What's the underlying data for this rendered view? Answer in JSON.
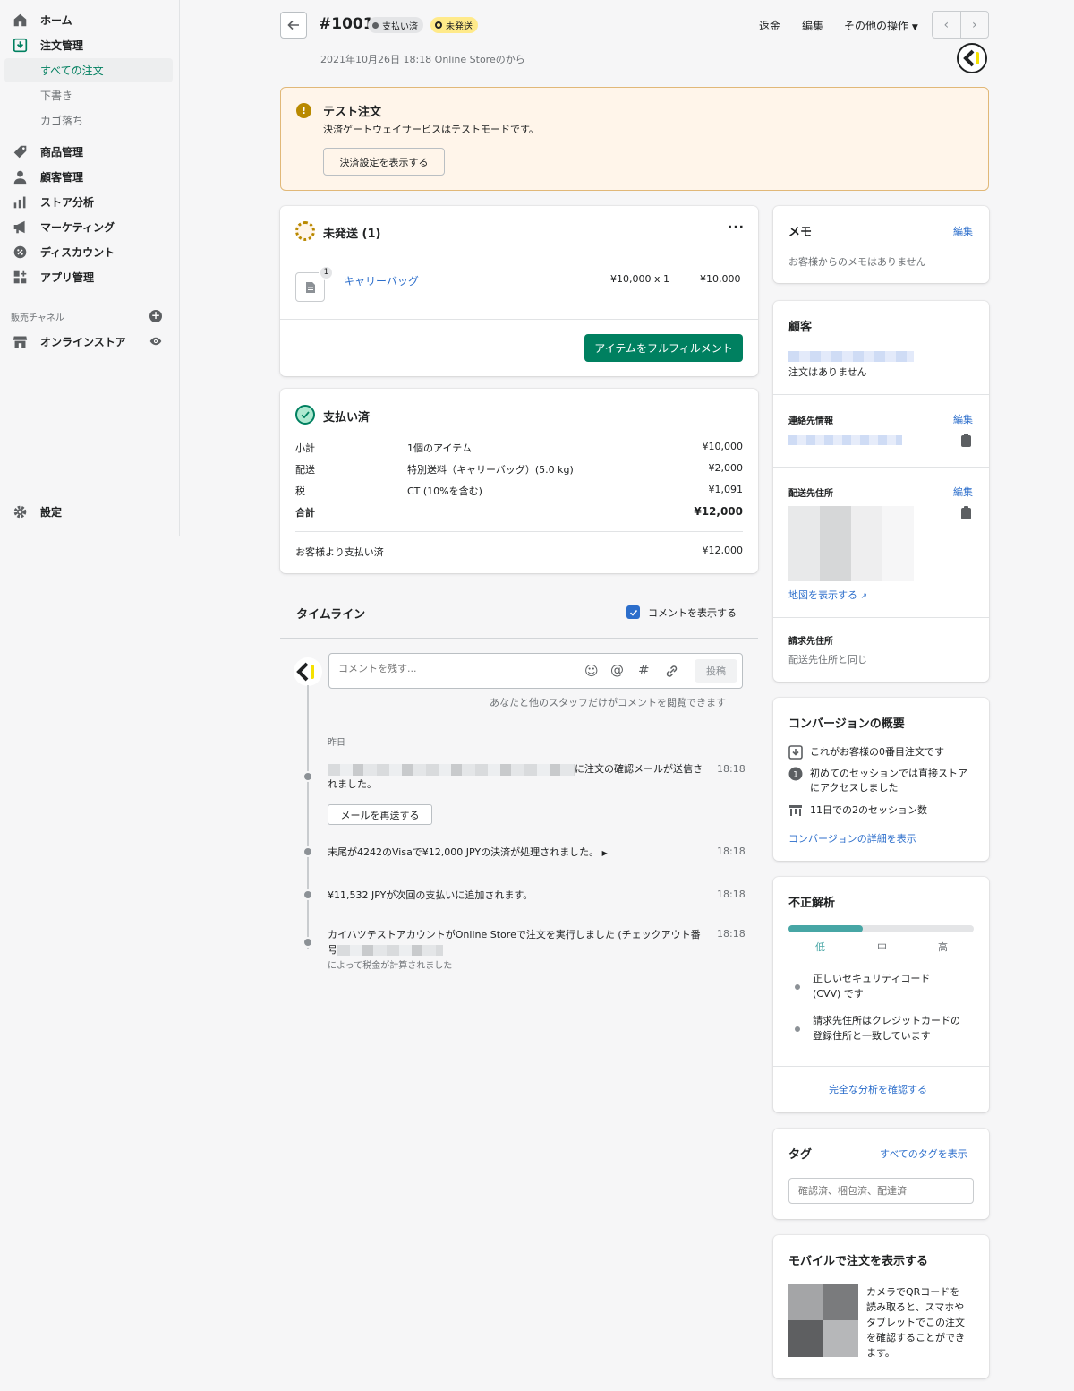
{
  "sidebar": {
    "items": [
      {
        "label": "ホーム",
        "icon": "home-icon"
      },
      {
        "label": "注文管理",
        "icon": "orders-icon"
      },
      {
        "label": "商品管理",
        "icon": "tag-icon"
      },
      {
        "label": "顧客管理",
        "icon": "person-icon"
      },
      {
        "label": "ストア分析",
        "icon": "analytics-icon"
      },
      {
        "label": "マーケティング",
        "icon": "megaphone-icon"
      },
      {
        "label": "ディスカウント",
        "icon": "discount-icon"
      },
      {
        "label": "アプリ管理",
        "icon": "apps-icon"
      }
    ],
    "orders_sub": [
      "すべての注文",
      "下書き",
      "カゴ落ち"
    ],
    "channels_label": "販売チャネル",
    "online_store": "オンラインストア",
    "settings": "設定"
  },
  "header": {
    "title": "#1001",
    "badge_paid": "支払い済",
    "badge_unfulfilled": "未発送",
    "subtitle": "2021年10月26日 18:18 Online Storeのから",
    "refund": "返金",
    "edit": "編集",
    "more_actions": "その他の操作"
  },
  "banner": {
    "title": "テスト注文",
    "text": "決済ゲートウェイサービスはテストモードです。",
    "button": "決済設定を表示する"
  },
  "fulfillment": {
    "title": "未発送 (1)",
    "item_name": "キャリーバッグ",
    "item_qty_badge": "1",
    "item_price": "¥10,000 x 1",
    "item_total": "¥10,000",
    "button": "アイテムをフルフィルメント"
  },
  "payment": {
    "title": "支払い済",
    "rows": [
      {
        "label": "小計",
        "desc": "1個のアイテム",
        "amount": "¥10,000"
      },
      {
        "label": "配送",
        "desc": "特別送料（キャリーバッグ）(5.0 kg)",
        "amount": "¥2,000"
      },
      {
        "label": "税",
        "desc": "CT (10%を含む)",
        "amount": "¥1,091"
      },
      {
        "label": "合計",
        "desc": "",
        "amount": "¥12,000"
      }
    ],
    "paid_label": "お客様より支払い済",
    "paid_amount": "¥12,000"
  },
  "timeline": {
    "title": "タイムライン",
    "show_comments": "コメントを表示する",
    "comment_placeholder": "コメントを残す...",
    "post": "投稿",
    "hint": "あなたと他のスタッフだけがコメントを閲覧できます",
    "day": "昨日",
    "events": [
      {
        "text": "に注文の確認メールが送信されました。",
        "time": "18:18"
      },
      {
        "text": "末尾が4242のVisaで¥12,000 JPYの決済が処理されました。",
        "time": "18:18"
      },
      {
        "text": "¥11,532 JPYが次回の支払いに追加されます。",
        "time": "18:18"
      },
      {
        "text": "カイハツテストアカウントがOnline Storeで注文を実行しました (チェックアウト番号",
        "time": "18:18"
      }
    ],
    "resend": "メールを再送する",
    "tax_note": "によって税金が計算されました"
  },
  "notes": {
    "title": "メモ",
    "edit": "編集",
    "text": "お客様からのメモはありません"
  },
  "customer": {
    "title": "顧客",
    "no_orders": "注文はありません",
    "contact_title": "連絡先情報",
    "contact_edit": "編集",
    "shipping_title": "配送先住所",
    "shipping_edit": "編集",
    "map_link": "地図を表示する",
    "billing_title": "請求先住所",
    "billing_text": "配送先住所と同じ"
  },
  "conversion": {
    "title": "コンバージョンの概要",
    "rows": [
      {
        "text": "これがお客様の0番目注文です"
      },
      {
        "text": "初めてのセッションでは直接ストアにアクセスしました"
      },
      {
        "text": "11日での2のセッション数"
      }
    ],
    "link": "コンバージョンの詳細を表示"
  },
  "fraud": {
    "title": "不正解析",
    "risk_level": 0.4,
    "low": "低",
    "mid": "中",
    "high": "高",
    "items": [
      "正しいセキュリティコード (CVV) です",
      "請求先住所はクレジットカードの登録住所と一致しています"
    ],
    "link": "完全な分析を確認する"
  },
  "tags": {
    "title": "タグ",
    "link": "すべてのタグを表示",
    "placeholder": "確認済、梱包済、配達済"
  },
  "mobile": {
    "title": "モバイルで注文を表示する",
    "text": "カメラでQRコードを読み取ると、スマホやタブレットでこの注文を確認することができます。"
  },
  "colors": {
    "accent": "#008060",
    "link": "#2c6ecb",
    "warning_bg": "#fff5ea",
    "unfulfilled": "#ffea8a"
  }
}
